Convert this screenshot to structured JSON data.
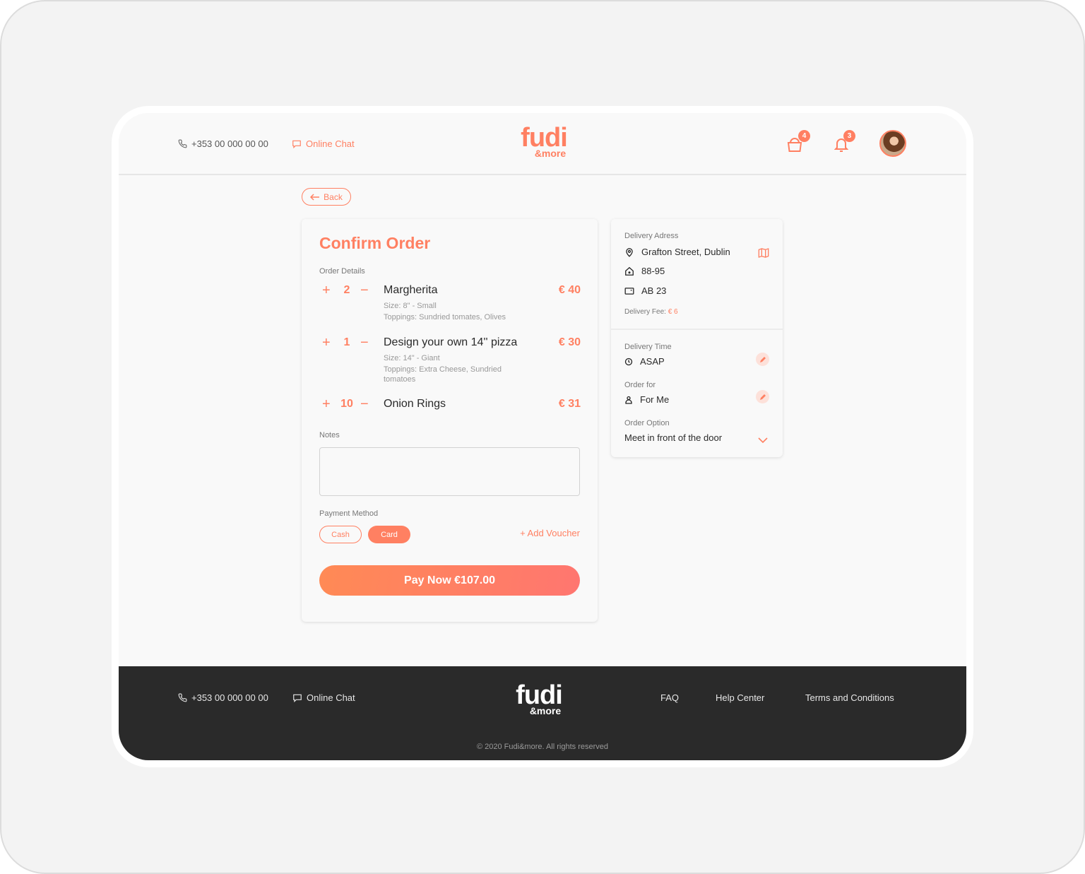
{
  "header": {
    "phone": "+353 00 000 00 00",
    "chat_label": "Online Chat",
    "logo_main": "fudi",
    "logo_sub": "&more",
    "cart_badge": "4",
    "notifications_badge": "3"
  },
  "back_label": "Back",
  "order": {
    "title": "Confirm Order",
    "details_label": "Order Details",
    "items": [
      {
        "qty": "2",
        "name": "Margherita",
        "price": "€ 40",
        "size": "Size: 8\" - Small",
        "toppings": "Toppings: Sundried tomates, Olives"
      },
      {
        "qty": "1",
        "name": "Design your own 14'' pizza",
        "price": "€ 30",
        "size": "Size: 14\" - Giant",
        "toppings": "Toppings: Extra Cheese, Sundried tomatoes"
      },
      {
        "qty": "10",
        "name": "Onion Rings",
        "price": "€ 31"
      }
    ],
    "notes_label": "Notes",
    "notes_value": "",
    "payment_label": "Payment Method",
    "payment_options": [
      "Cash",
      "Card"
    ],
    "payment_selected": "Card",
    "voucher_label": "+ Add Voucher",
    "pay_button": "Pay Now €107.00"
  },
  "delivery": {
    "address_label": "Delivery Adress",
    "street": "Grafton Street, Dublin",
    "house": "88-95",
    "postcode": "AB 23",
    "fee_label": "Delivery Fee:",
    "fee_value": "€ 6",
    "time_label": "Delivery Time",
    "time_value": "ASAP",
    "order_for_label": "Order for",
    "order_for_value": "For Me",
    "option_label": "Order Option",
    "option_value": "Meet in front of the door"
  },
  "footer": {
    "phone": "+353 00 000 00 00",
    "chat_label": "Online Chat",
    "logo_main": "fudi",
    "logo_sub": "&more",
    "links": [
      "FAQ",
      "Help Center",
      "Terms and Conditions"
    ],
    "copyright": "© 2020 Fudi&more. All rights reserved"
  },
  "colors": {
    "accent": "#ff8062",
    "footer_bg": "#2a2a2a",
    "page_bg": "#f9f9f9"
  }
}
